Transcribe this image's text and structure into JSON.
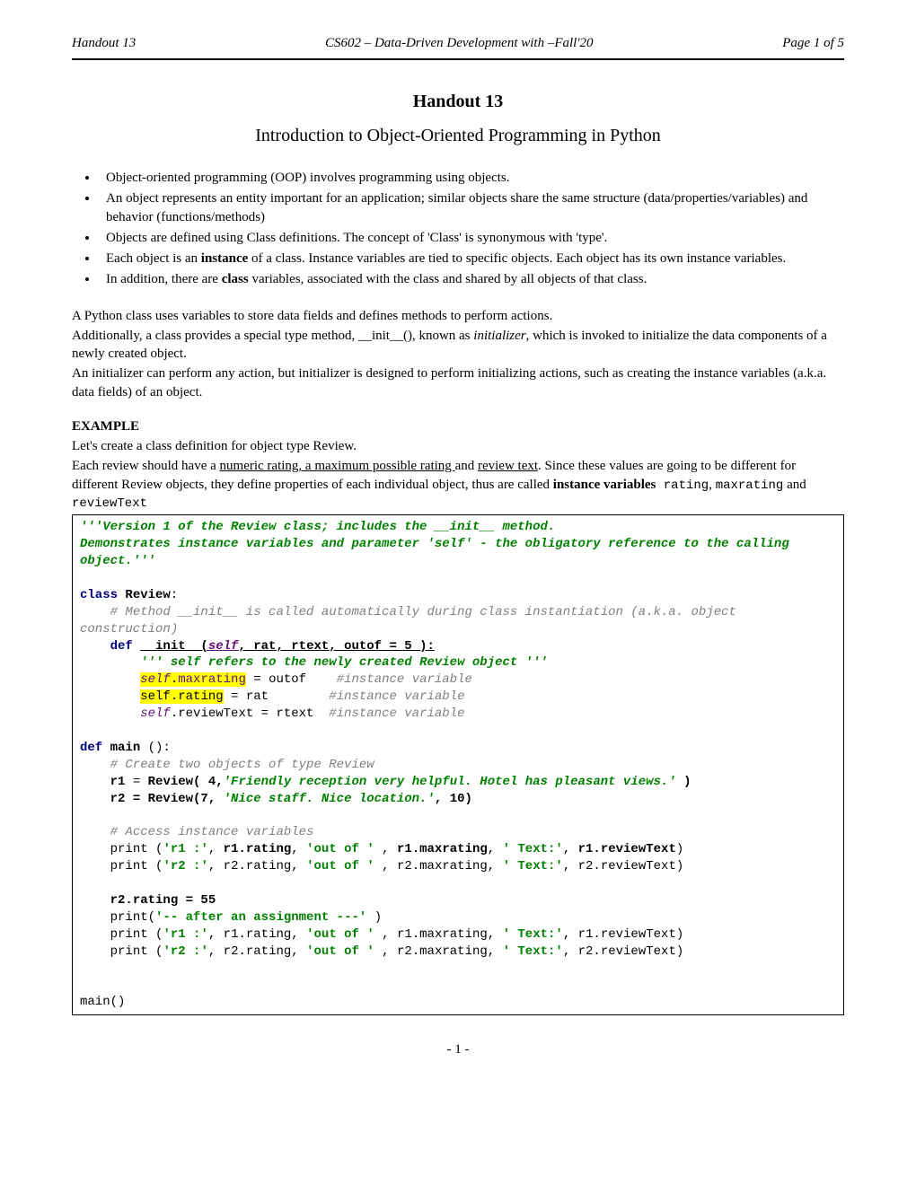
{
  "header": {
    "left": "Handout 13",
    "center": "CS602 – Data-Driven Development with –Fall'20",
    "right": "Page 1 of 5"
  },
  "title": "Handout 13",
  "subtitle": "Introduction to Object-Oriented Programming in Python",
  "bullets": {
    "b1": "Object-oriented programming (OOP) involves programming using objects.",
    "b2": "An object represents an entity important for an application; similar objects share the same structure (data/properties/variables) and behavior (functions/methods)",
    "b3": "Objects are defined using Class definitions.  The concept of 'Class' is synonymous with 'type'.",
    "b4a": "Each object is an ",
    "b4b": "instance",
    "b4c": " of a class. Instance variables are tied to specific objects. Each object has its own instance variables.",
    "b5a": "In addition, there are ",
    "b5b": "class",
    "b5c": " variables, associated with the class and shared by all objects of that class."
  },
  "para1": {
    "l1": "A Python class uses variables to store data fields and defines methods to perform actions.",
    "l2a": "Additionally, a class provides a special type method, __init__(), known as ",
    "l2b": "initializer",
    "l2c": ", which is invoked to initialize the data components of a newly created object.",
    "l3": "An initializer can perform any action, but initializer is designed to perform initializing actions, such as creating the instance variables (a.k.a. data fields) of an object."
  },
  "example_label": "EXAMPLE",
  "para2": {
    "l1": "Let's create a class definition for object type Review.",
    "l2a": "Each review should have a ",
    "l2b": "numeric rating, a maximum possible rating ",
    "l2c": "and ",
    "l2d": "review text",
    "l2e": ". Since these values are going to be different for different Review objects, they define properties of each individual object, thus are called ",
    "l2f": "instance variables",
    "l2g": " rating",
    "l2h": ", ",
    "l2i": "maxrating",
    "l2j": " and ",
    "l2k": "reviewText"
  },
  "code": {
    "doc1": "'''Version 1 of the Review class; includes the __init__ method.",
    "doc2": "Demonstrates instance variables and  parameter 'self' - the obligatory reference to the calling object.'''",
    "class_kw": "class ",
    "class_name": "Review",
    "colon": ":",
    "comment1": "# Method __init__ is called automatically during class instantiation (a.k.a. object construction)",
    "indent4": "    ",
    "indent8": "        ",
    "def_kw": "def ",
    "init_u": "__init__(",
    "self_p": "self",
    "init_params": ", rat,  rtext, outof = 5 ):",
    "doc3": "''' self refers to the newly created Review object '''",
    "self_dot": "self",
    "dot": ".",
    "maxrating": "maxrating",
    "eq_outof": " = outof    ",
    "c_iv": "#instance variable",
    "rating": "rating",
    "eq_rat": " = rat        ",
    "reviewText": "reviewText",
    "eq_rtext": " = rtext  ",
    "main_name": "main ",
    "main_par": "():",
    "comment2": "# Create two objects of type Review",
    "r1eq": "r1 ",
    "eq": "= ",
    "rev_call": "Review( 4,",
    "str_friendly": "'Friendly reception very helpful. Hotel has pleasant views.'",
    "close_paren": " )",
    "r2line": "r2 = Review(7, ",
    "str_nice": "'Nice staff. Nice location.'",
    "r2end": ", 10)",
    "comment3": "# Access instance variables",
    "print_kw": "print ",
    "open_p": "(",
    "str_r1": "'r1 :'",
    "comma_sp": ", ",
    "r1rating": "r1.rating",
    "str_outof": "'out of '",
    "r1max": "r1.maxrating",
    "str_text": "' Text:'",
    "r1rt": "r1.reviewText",
    "close_p": ")",
    "str_r2": "'r2 :'",
    "r2rating": "r2.rating",
    "r2max": "r2.maxrating",
    "r2rt": "r2.reviewText",
    "r2assign": "r2.rating = 55",
    "printnp": "print",
    "str_after": "'-- after an assignment ---'",
    "main_call": "main()"
  },
  "footer": "- 1 -"
}
